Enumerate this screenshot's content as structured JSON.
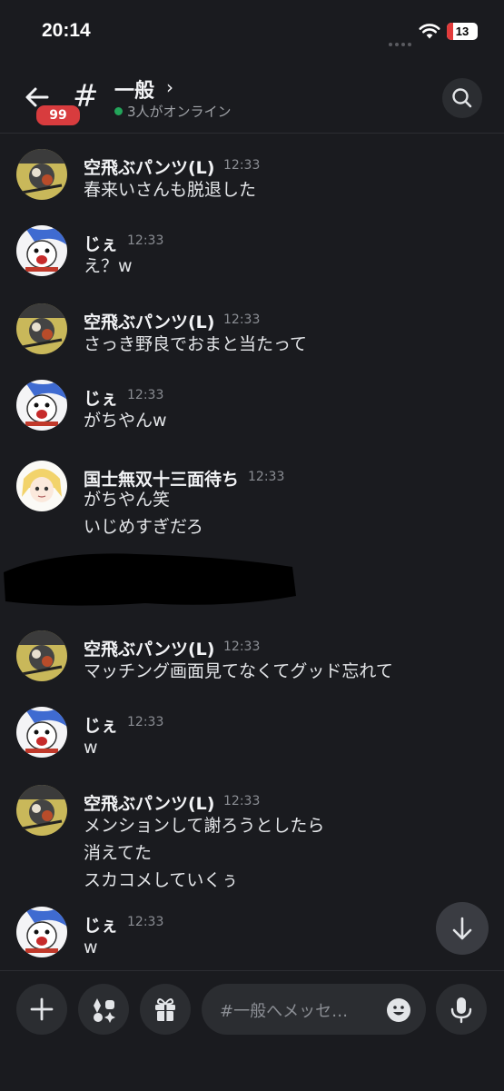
{
  "status": {
    "time": "20:14",
    "battery": "13"
  },
  "header": {
    "back_badge": "99",
    "hash": "#",
    "channel": "一般",
    "chevron": "›",
    "online": "3人がオンライン"
  },
  "messages": [
    {
      "author": "空飛ぶパンツ(L)",
      "time": "12:33",
      "lines": [
        "春来いさんも脱退した"
      ]
    },
    {
      "author": "じぇ",
      "time": "12:33",
      "lines": [
        "え？w"
      ]
    },
    {
      "author": "空飛ぶパンツ(L)",
      "time": "12:33",
      "lines": [
        "さっき野良でおまと当たって"
      ]
    },
    {
      "author": "じぇ",
      "time": "12:33",
      "lines": [
        "がちやんw"
      ]
    },
    {
      "author": "国士無双十三面待ち",
      "time": "12:33",
      "lines": [
        "がちやん笑",
        "いじめすぎだろ"
      ]
    },
    {
      "author": "空飛ぶパンツ(L)",
      "time": "12:33",
      "lines": [
        "マッチング画面見てなくてグッド忘れて"
      ]
    },
    {
      "author": "じぇ",
      "time": "12:33",
      "lines": [
        "w"
      ]
    },
    {
      "author": "空飛ぶパンツ(L)",
      "time": "12:33",
      "lines": [
        "メンションして謝ろうとしたら",
        "消えてた",
        "スカコメしていくぅ"
      ]
    },
    {
      "author": "じぇ",
      "time": "12:33",
      "lines": [
        "w"
      ]
    }
  ],
  "composer": {
    "placeholder": "#一般へメッセ…"
  },
  "icons": {
    "back": "arrow-left-icon",
    "search": "search-icon",
    "plus": "plus-icon",
    "apps": "apps-icon",
    "gift": "gift-icon",
    "emoji": "emoji-icon",
    "mic": "microphone-icon",
    "scroll": "arrow-down-icon"
  }
}
